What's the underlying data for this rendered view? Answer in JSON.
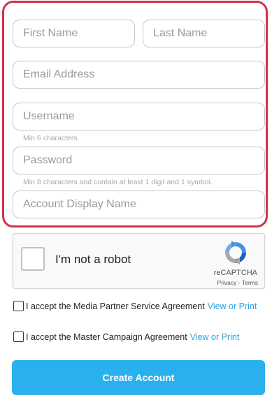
{
  "form": {
    "first_name_placeholder": "First Name",
    "last_name_placeholder": "Last Name",
    "email_placeholder": "Email Address",
    "username_placeholder": "Username",
    "username_hint": "Min 6 characters.",
    "password_placeholder": "Password",
    "password_hint": "Min 8 characters and contain at least 1 digit and 1 symbol.",
    "display_name_placeholder": "Account Display Name"
  },
  "captcha": {
    "label": "I'm not a robot",
    "brand": "reCAPTCHA",
    "privacy": "Privacy",
    "separator": "-",
    "terms": "Terms"
  },
  "agreements": [
    {
      "text": "I accept the Media Partner Service Agreement",
      "link": "View or Print"
    },
    {
      "text": "I accept the Master Campaign Agreement",
      "link": "View or Print"
    }
  ],
  "submit_label": "Create Account",
  "colors": {
    "highlight_border": "#d6304a",
    "accent": "#2ab0ed",
    "link": "#2a9fe0"
  },
  "icons": [
    "recaptcha-logo-icon",
    "checkbox-icon"
  ]
}
